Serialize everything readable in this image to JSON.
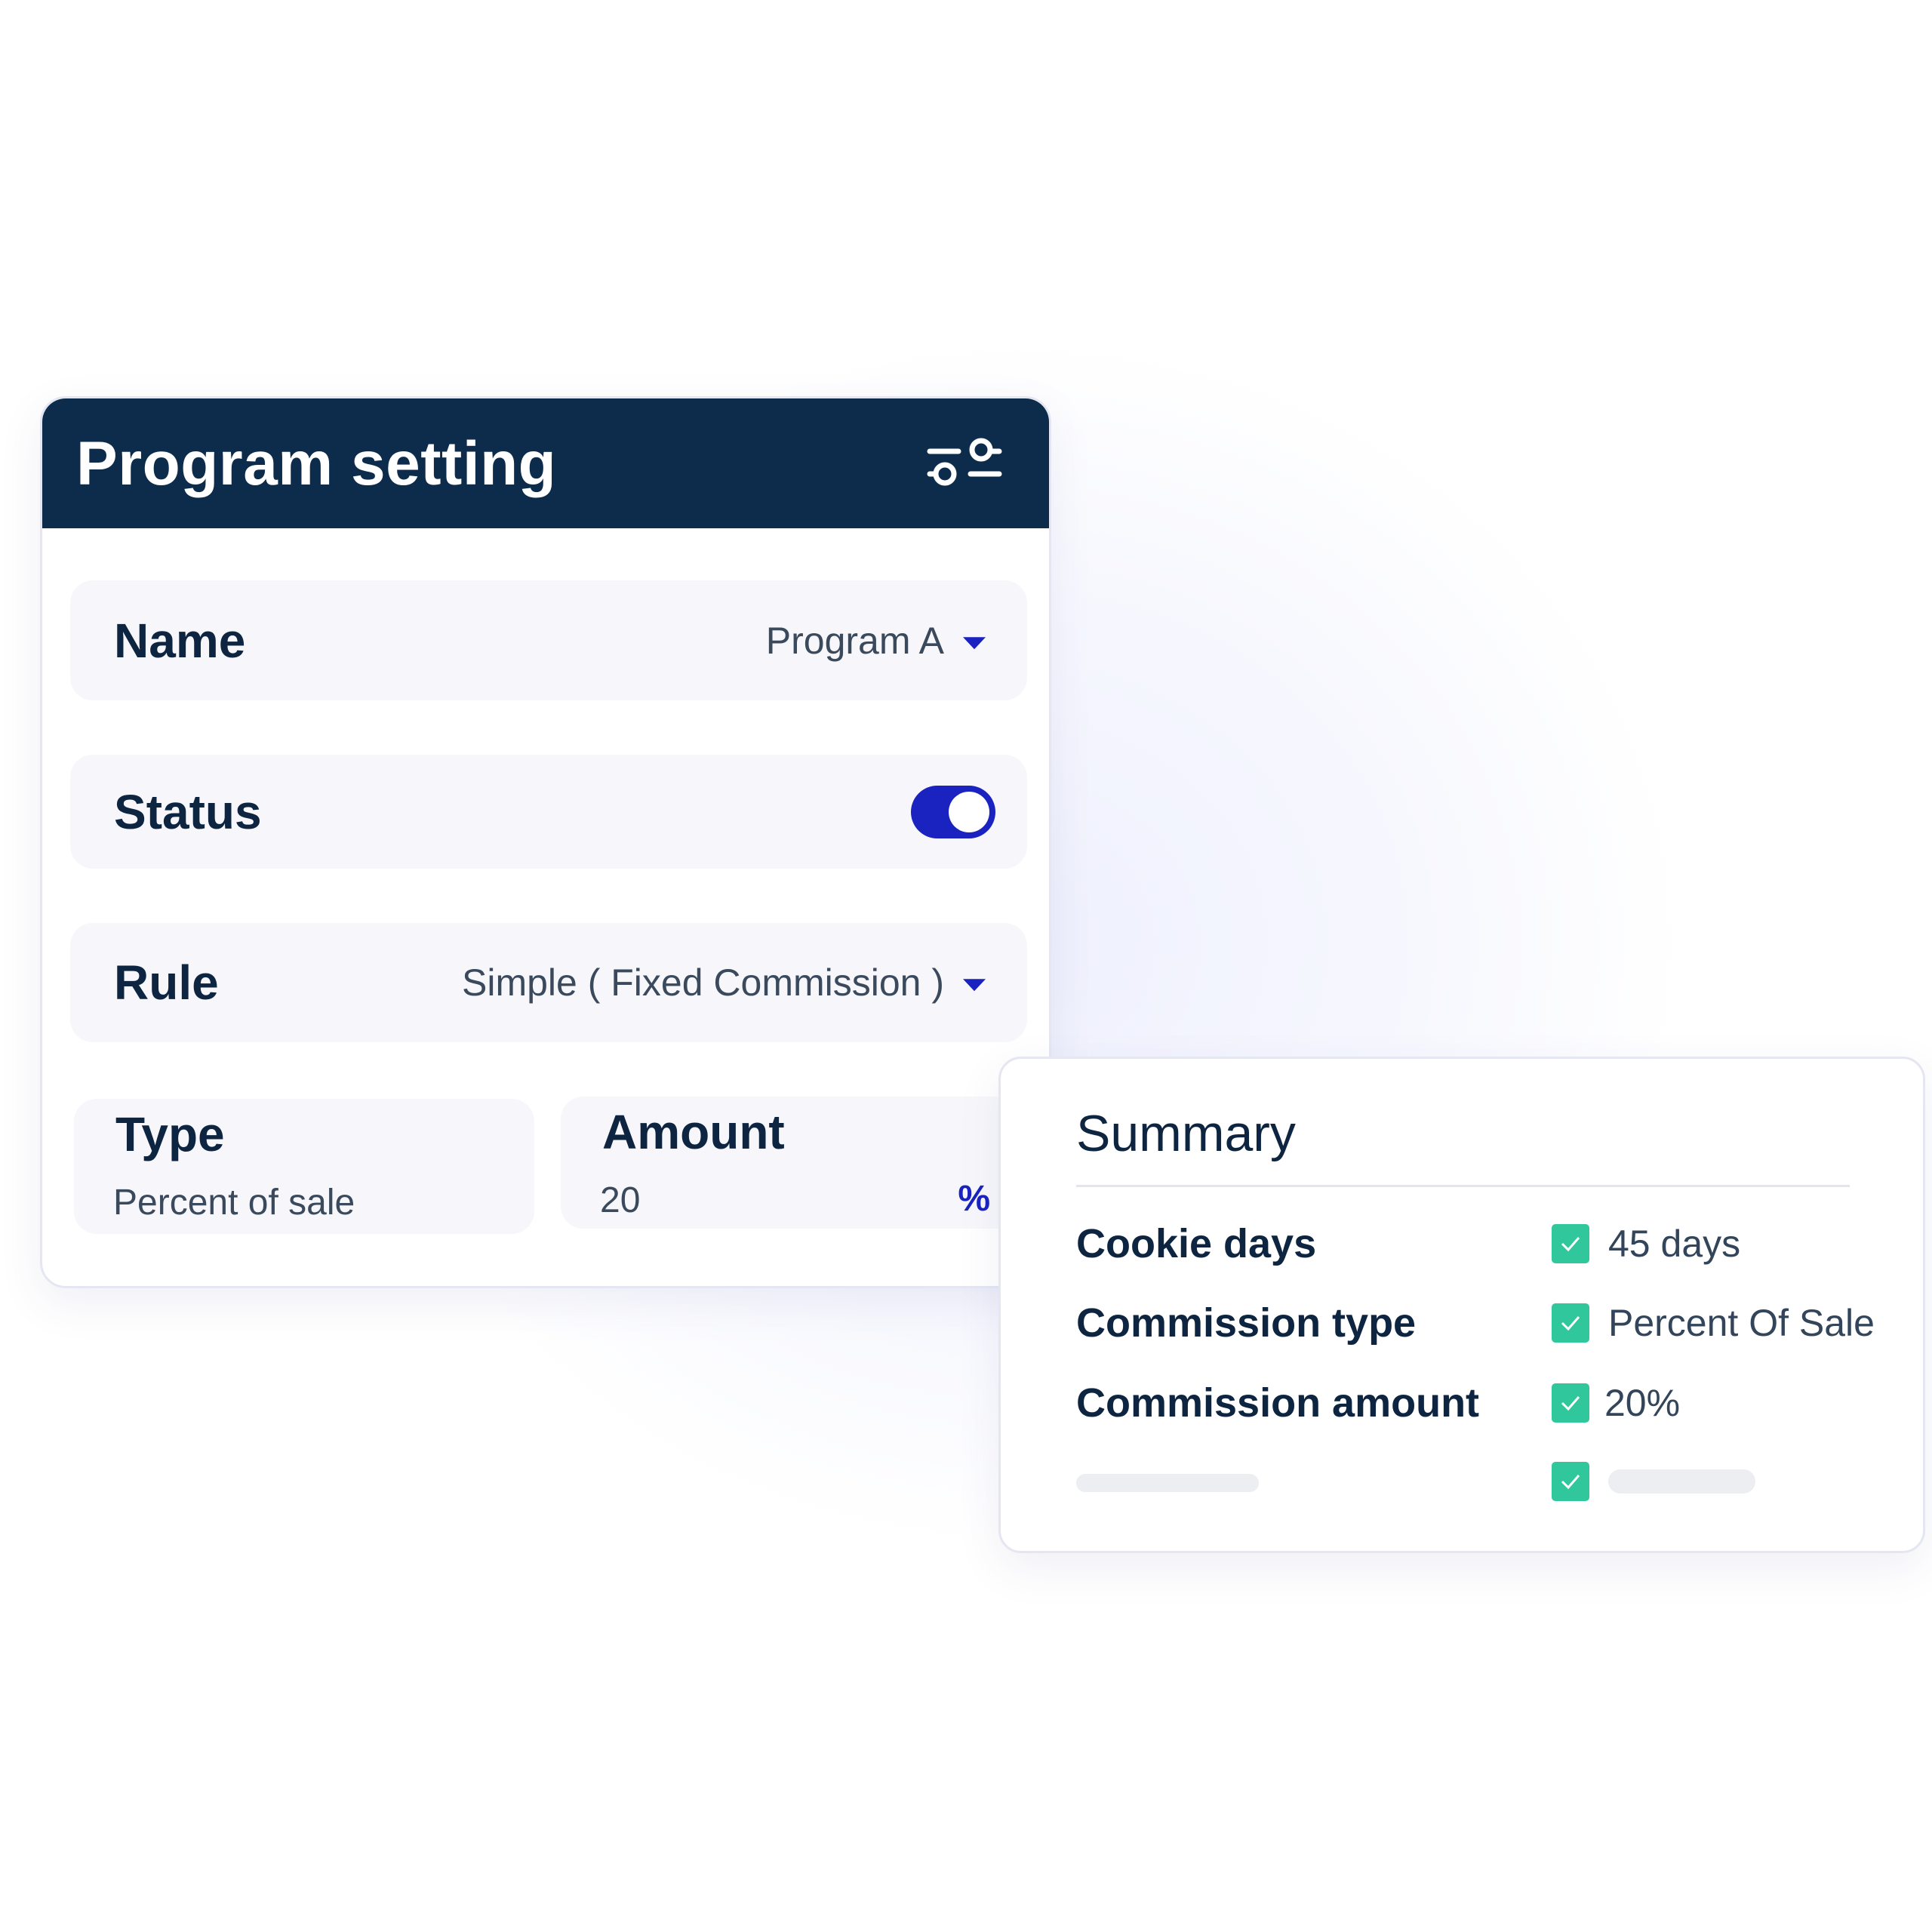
{
  "program_setting": {
    "title": "Program setting",
    "settings_icon": "sliders-icon",
    "name": {
      "label": "Name",
      "value": "Program A"
    },
    "status": {
      "label": "Status",
      "enabled": true
    },
    "rule": {
      "label": "Rule",
      "value": "Simple ( Fixed Commission )"
    },
    "type": {
      "label": "Type",
      "value": "Percent of sale"
    },
    "amount": {
      "label": "Amount",
      "value": "20",
      "unit": "%"
    }
  },
  "summary": {
    "title": "Summary",
    "rows": [
      {
        "label": "Cookie days",
        "value": "45 days",
        "checked": true
      },
      {
        "label": "Commission type",
        "value": "Percent Of Sale",
        "checked": true
      },
      {
        "label": "Commission amount",
        "value": "20%",
        "checked": true
      },
      {
        "label": "",
        "value": "",
        "checked": true,
        "placeholder": true
      }
    ]
  },
  "colors": {
    "header": "#0d2b4b",
    "accent": "#1a22c0",
    "check": "#2fc79b"
  }
}
